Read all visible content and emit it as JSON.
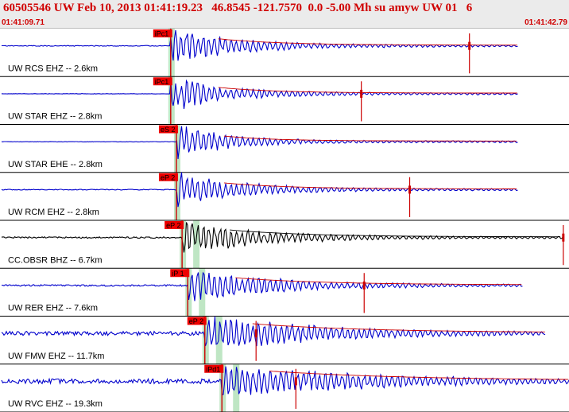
{
  "header": {
    "title": "60505546 UW Feb 10, 2013 01:41:19.23   46.8545 -121.7570  0.0 -5.00 Mh su amyw UW 01   6",
    "start_time": "01:41:09.71",
    "end_time": "01:41:42.79"
  },
  "colors": {
    "trace": "#0000cc",
    "trace_black": "#000000",
    "pick": "#cc0000",
    "pick_label_bg": "#ee0000",
    "window_green": "#bfe6c4",
    "separator": "#000000",
    "header_bg": "#ebebeb"
  },
  "chart_data": {
    "type": "seismogram",
    "time_range": [
      "01:41:09.71",
      "01:41:42.79"
    ],
    "grid": false,
    "traces": [
      {
        "label": "UW RCS EHZ -- 2.6km",
        "pick_label": "iPc1",
        "color": "blue",
        "onset_frac": 0.3,
        "noise": 0.02,
        "amp": 0.95,
        "decay": 2.2,
        "end_frac": 0.91,
        "coda_marker_frac": 0.825,
        "seed": 11
      },
      {
        "label": "UW STAR EHZ -- 2.8km",
        "pick_label": "iPc1",
        "color": "blue",
        "onset_frac": 0.3,
        "noise": 0.01,
        "amp": 0.9,
        "decay": 2.4,
        "end_frac": 0.91,
        "coda_marker_frac": 0.635,
        "seed": 23
      },
      {
        "label": "UW STAR EHE -- 2.8km",
        "pick_label": "eS 2",
        "color": "blue",
        "onset_frac": 0.31,
        "noise": 0.01,
        "amp": 0.9,
        "decay": 2.8,
        "end_frac": 0.91,
        "coda_marker_frac": null,
        "seed": 37
      },
      {
        "label": "UW RCM EHZ -- 2.8km",
        "pick_label": "eP 2",
        "color": "blue",
        "onset_frac": 0.31,
        "noise": 0.02,
        "amp": 0.9,
        "decay": 2.2,
        "end_frac": 0.91,
        "coda_marker_frac": 0.72,
        "seed": 41
      },
      {
        "label": "CC.OBSR BHZ -- 6.7km",
        "pick_label": "eP 2",
        "color": "black",
        "onset_frac": 0.32,
        "noise": 0.04,
        "amp": 0.9,
        "decay": 1.8,
        "end_frac": 0.99,
        "coda_marker_frac": 0.99,
        "seed": 53
      },
      {
        "label": "UW RER EHZ -- 7.6km",
        "pick_label": "iP 1",
        "color": "blue",
        "onset_frac": 0.33,
        "noise": 0.04,
        "amp": 0.85,
        "decay": 1.6,
        "end_frac": 0.92,
        "coda_marker_frac": 0.64,
        "seed": 67
      },
      {
        "label": "UW FMW EHZ -- 11.7km",
        "pick_label": "eP 2",
        "color": "blue",
        "onset_frac": 0.36,
        "noise": 0.1,
        "amp": 0.95,
        "decay": 1.2,
        "end_frac": 0.96,
        "coda_marker_frac": 0.45,
        "seed": 79
      },
      {
        "label": "UW RVC EHZ -- 19.3km",
        "pick_label": "iPd1",
        "color": "blue",
        "onset_frac": 0.39,
        "noise": 0.12,
        "amp": 0.95,
        "decay": 1.0,
        "end_frac": 1.0,
        "coda_marker_frac": 0.52,
        "seed": 83
      }
    ]
  }
}
